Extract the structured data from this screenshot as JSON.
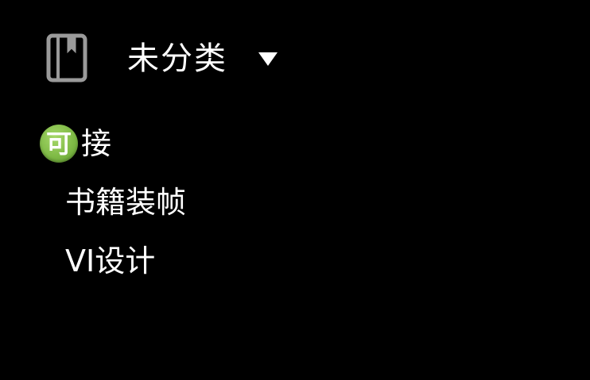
{
  "header": {
    "notebook_icon": "notebook-icon",
    "category_label": "未分类",
    "dropdown_icon": "chevron-down-icon"
  },
  "tags": [
    {
      "emoji_char": "可",
      "emoji_icon": "ke-emoji-icon",
      "label": "接"
    },
    {
      "label": "书籍装帧"
    },
    {
      "label": "VI设计"
    }
  ],
  "colors": {
    "background": "#000000",
    "text": "#ffffff",
    "icon_stroke": "#9a9a9a",
    "emoji_green": "#7fba46"
  }
}
